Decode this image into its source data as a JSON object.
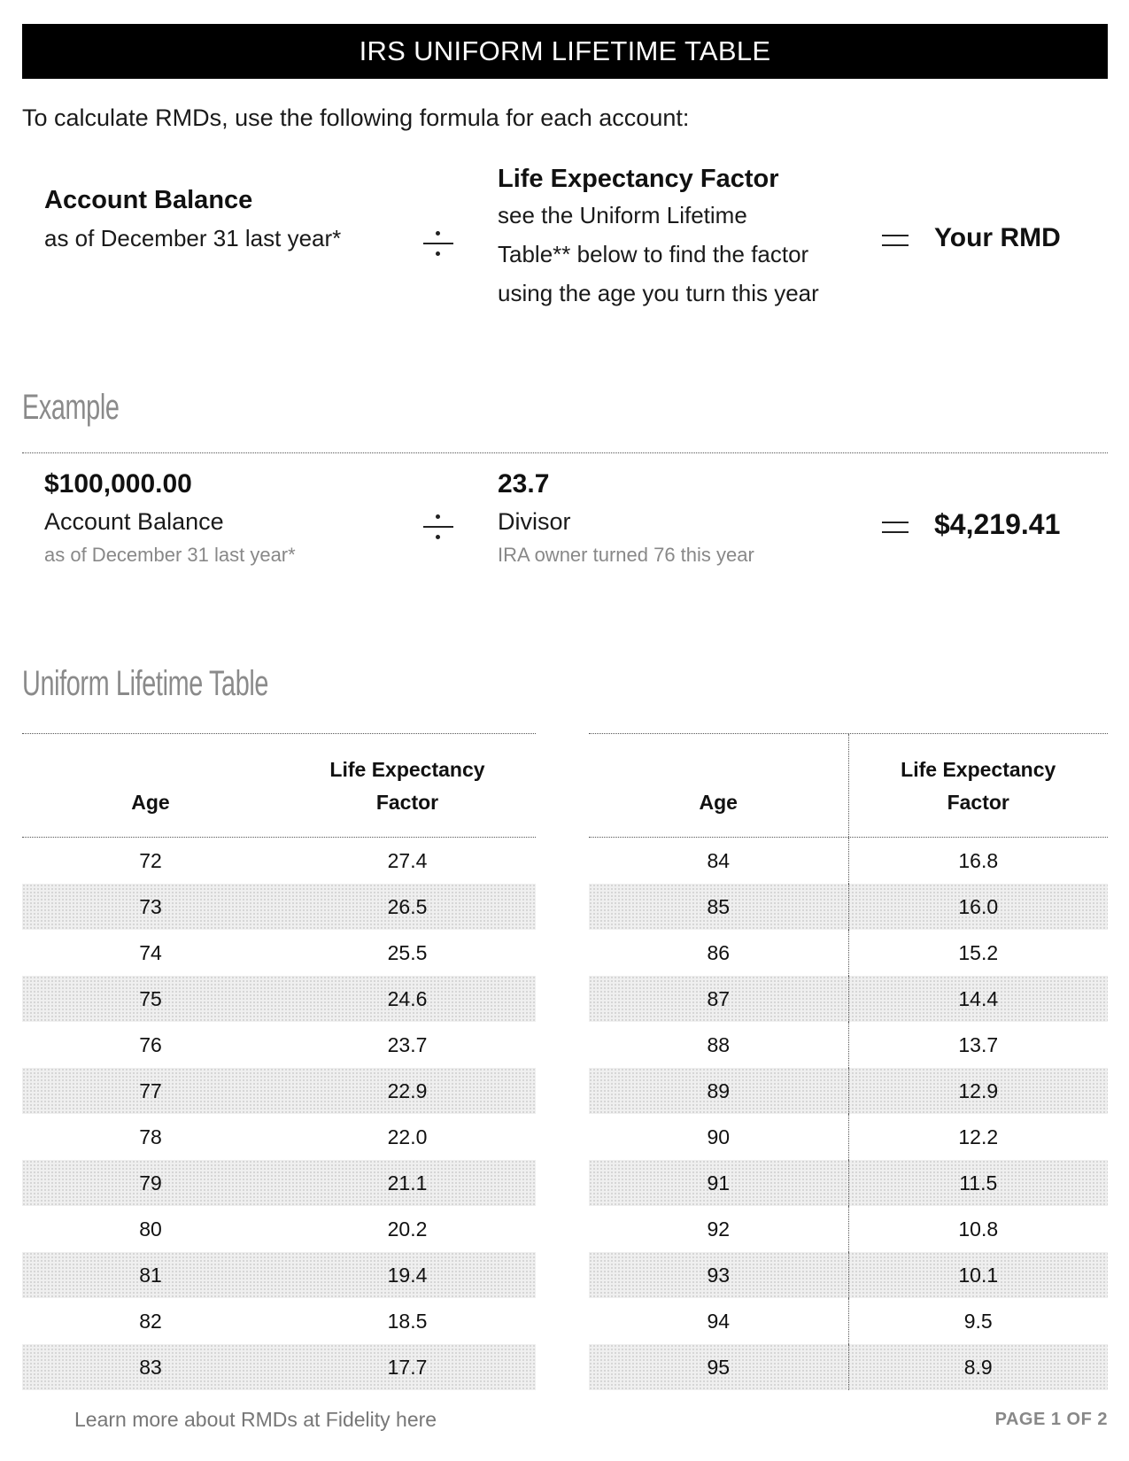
{
  "header": {
    "title": "IRS UNIFORM LIFETIME TABLE"
  },
  "intro": "To calculate RMDs, use the following formula for each account:",
  "formula": {
    "left": {
      "title": "Account Balance",
      "subtitle": "as of December 31 last year*"
    },
    "operator_divide": "divide-icon",
    "middle": {
      "title": "Life Expectancy Factor",
      "lines": [
        "see the Uniform Lifetime",
        "Table** below to find the factor",
        "using the age you turn this year"
      ]
    },
    "operator_equals": "equals-icon",
    "result": "Your RMD"
  },
  "example": {
    "title": "Example",
    "balance": {
      "value": "$100,000.00",
      "label": "Account Balance",
      "sub": "as of December 31 last year*"
    },
    "divisor": {
      "value": "23.7",
      "label": "Divisor",
      "sub": "IRA owner turned 76 this year"
    },
    "result": "$4,219.41"
  },
  "table": {
    "title": "Uniform Lifetime Table",
    "headers": {
      "age": "Age",
      "factor_line1": "Life Expectancy",
      "factor_line2": "Factor"
    },
    "left_rows": [
      {
        "age": "72",
        "factor": "27.4"
      },
      {
        "age": "73",
        "factor": "26.5"
      },
      {
        "age": "74",
        "factor": "25.5"
      },
      {
        "age": "75",
        "factor": "24.6"
      },
      {
        "age": "76",
        "factor": "23.7"
      },
      {
        "age": "77",
        "factor": "22.9"
      },
      {
        "age": "78",
        "factor": "22.0"
      },
      {
        "age": "79",
        "factor": "21.1"
      },
      {
        "age": "80",
        "factor": "20.2"
      },
      {
        "age": "81",
        "factor": "19.4"
      },
      {
        "age": "82",
        "factor": "18.5"
      },
      {
        "age": "83",
        "factor": "17.7"
      }
    ],
    "right_rows": [
      {
        "age": "84",
        "factor": "16.8"
      },
      {
        "age": "85",
        "factor": "16.0"
      },
      {
        "age": "86",
        "factor": "15.2"
      },
      {
        "age": "87",
        "factor": "14.4"
      },
      {
        "age": "88",
        "factor": "13.7"
      },
      {
        "age": "89",
        "factor": "12.9"
      },
      {
        "age": "90",
        "factor": "12.2"
      },
      {
        "age": "91",
        "factor": "11.5"
      },
      {
        "age": "92",
        "factor": "10.8"
      },
      {
        "age": "93",
        "factor": "10.1"
      },
      {
        "age": "94",
        "factor": "9.5"
      },
      {
        "age": "95",
        "factor": "8.9"
      }
    ]
  },
  "footer": {
    "link_text": "Learn more about RMDs at Fidelity here",
    "page": "PAGE 1 OF 2"
  }
}
